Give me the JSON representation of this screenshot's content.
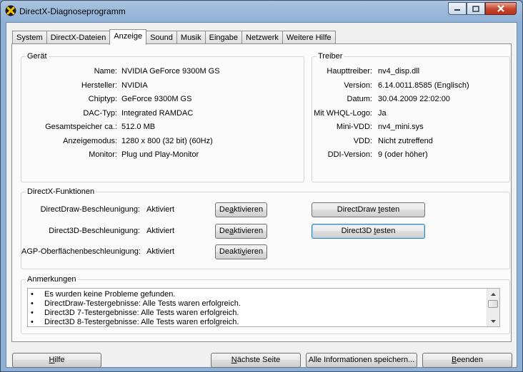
{
  "window": {
    "title": "DirectX-Diagnoseprogramm"
  },
  "tabs": [
    {
      "label": "System"
    },
    {
      "label": "DirectX-Dateien"
    },
    {
      "label": "Anzeige"
    },
    {
      "label": "Sound"
    },
    {
      "label": "Musik"
    },
    {
      "label": "Eingabe"
    },
    {
      "label": "Netzwerk"
    },
    {
      "label": "Weitere Hilfe"
    }
  ],
  "device": {
    "title": "Gerät",
    "rows": [
      {
        "label": "Name:",
        "value": "NVIDIA GeForce 9300M GS"
      },
      {
        "label": "Hersteller:",
        "value": "NVIDIA"
      },
      {
        "label": "Chiptyp:",
        "value": "GeForce 9300M GS"
      },
      {
        "label": "DAC-Typ:",
        "value": "Integrated RAMDAC"
      },
      {
        "label": "Gesamtspeicher ca.:",
        "value": "512.0 MB"
      },
      {
        "label": "Anzeigemodus:",
        "value": "1280 x 800 (32 bit) (60Hz)"
      },
      {
        "label": "Monitor:",
        "value": "Plug und Play-Monitor"
      }
    ]
  },
  "driver": {
    "title": "Treiber",
    "rows": [
      {
        "label": "Haupttreiber:",
        "value": "nv4_disp.dll"
      },
      {
        "label": "Version:",
        "value": "6.14.0011.8585 (Englisch)"
      },
      {
        "label": "Datum:",
        "value": "30.04.2009 22:02:00"
      },
      {
        "label": "Mit WHQL-Logo:",
        "value": "Ja"
      },
      {
        "label": "Mini-VDD:",
        "value": "nv4_mini.sys"
      },
      {
        "label": "VDD:",
        "value": "Nicht zutreffend"
      },
      {
        "label": "DDI-Version:",
        "value": "9 (oder höher)"
      }
    ]
  },
  "features": {
    "title": "DirectX-Funktionen",
    "rows": [
      {
        "label": "DirectDraw-Beschleunigung:",
        "status": "Aktiviert",
        "disable": {
          "pre": "De",
          "key": "a",
          "post": "ktivieren"
        },
        "test": {
          "pre": "DirectDraw ",
          "key": "t",
          "post": "esten"
        }
      },
      {
        "label": "Direct3D-Beschleunigung:",
        "status": "Aktiviert",
        "disable": {
          "pre": "De",
          "key": "a",
          "post": "ktivieren"
        },
        "test": {
          "pre": "Direct3D ",
          "key": "t",
          "post": "esten"
        }
      },
      {
        "label": "AGP-Oberflächenbeschleunigung:",
        "status": "Aktiviert",
        "disable": {
          "pre": "Deakti",
          "key": "v",
          "post": "ieren"
        }
      }
    ]
  },
  "notes": {
    "title": "Anmerkungen",
    "bullet": "•",
    "items": [
      "Es wurden keine Probleme gefunden.",
      "DirectDraw-Testergebnisse: Alle Tests waren erfolgreich.",
      "Direct3D 7-Testergebnisse: Alle Tests waren erfolgreich.",
      "Direct3D 8-Testergebnisse: Alle Tests waren erfolgreich."
    ]
  },
  "footer": {
    "help": {
      "pre": "",
      "key": "H",
      "post": "ilfe"
    },
    "next": {
      "pre": "",
      "key": "N",
      "post": "ächste Seite"
    },
    "saveall": {
      "pre": "Alle Informationen speichern...",
      "key": "",
      "post": ""
    },
    "exit": {
      "pre": "",
      "key": "B",
      "post": "eenden"
    }
  }
}
